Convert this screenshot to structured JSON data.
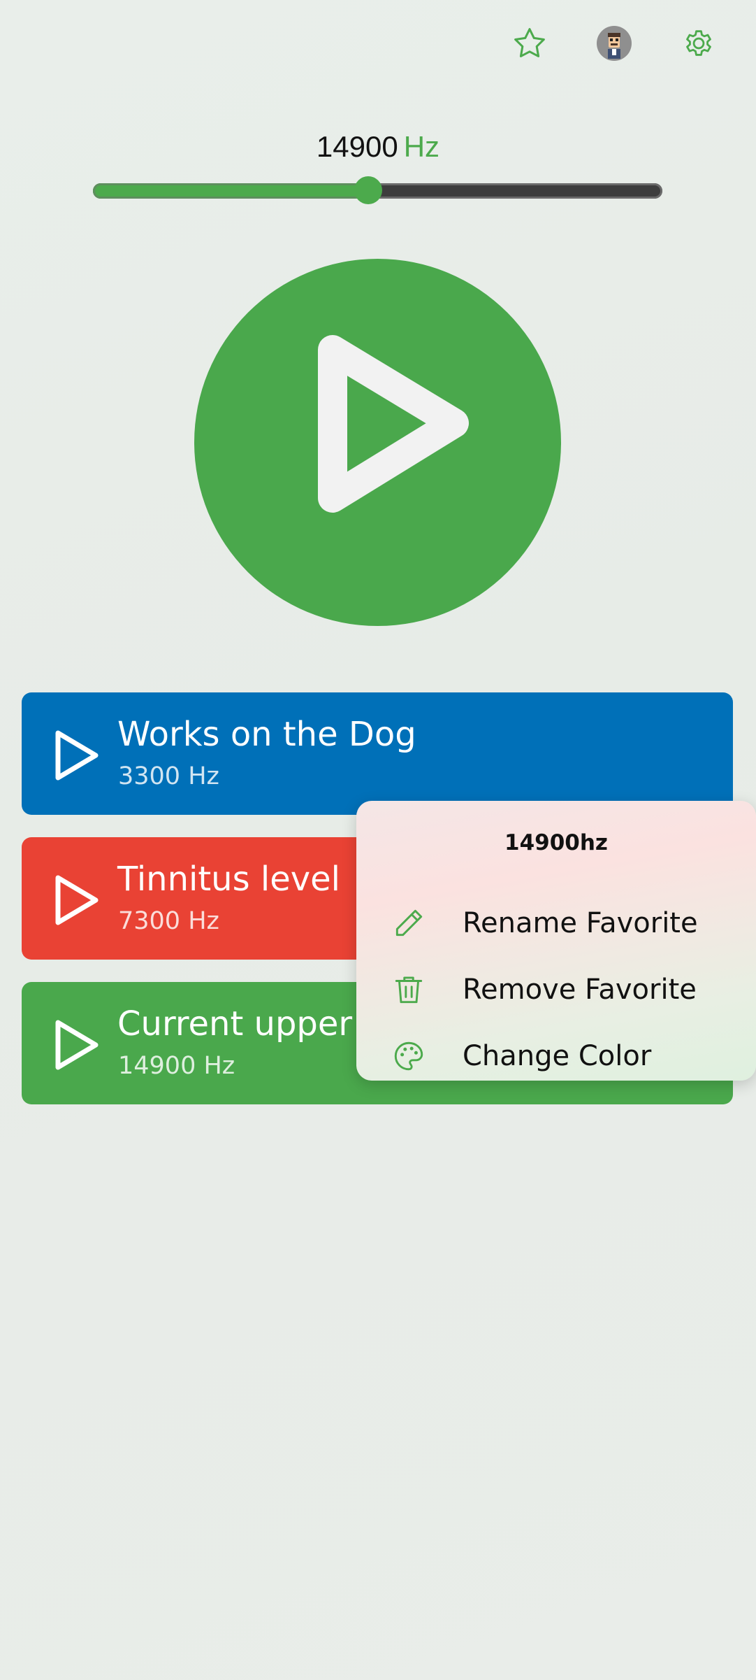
{
  "header": {
    "icons": [
      "star-icon",
      "avatar",
      "gear-icon"
    ]
  },
  "frequency": {
    "value": "14900",
    "unit": "Hz",
    "slider_fraction": 0.483
  },
  "colors": {
    "accent": "#4caa4c",
    "blue": "#0070b8",
    "red": "#e94234",
    "green": "#4aa84c"
  },
  "favorites": [
    {
      "name": "Works on the Dog",
      "freq": "3300 Hz",
      "color": "#0070b8"
    },
    {
      "name": "Tinnitus level",
      "freq": "7300 Hz",
      "color": "#e94234"
    },
    {
      "name": "Current upper r",
      "freq": "14900 Hz",
      "color": "#4aa84c"
    }
  ],
  "context_menu": {
    "title": "14900hz",
    "items": [
      {
        "label": "Rename Favorite",
        "icon": "pencil-icon"
      },
      {
        "label": "Remove Favorite",
        "icon": "trash-icon"
      },
      {
        "label": "Change Color",
        "icon": "palette-icon"
      }
    ]
  }
}
